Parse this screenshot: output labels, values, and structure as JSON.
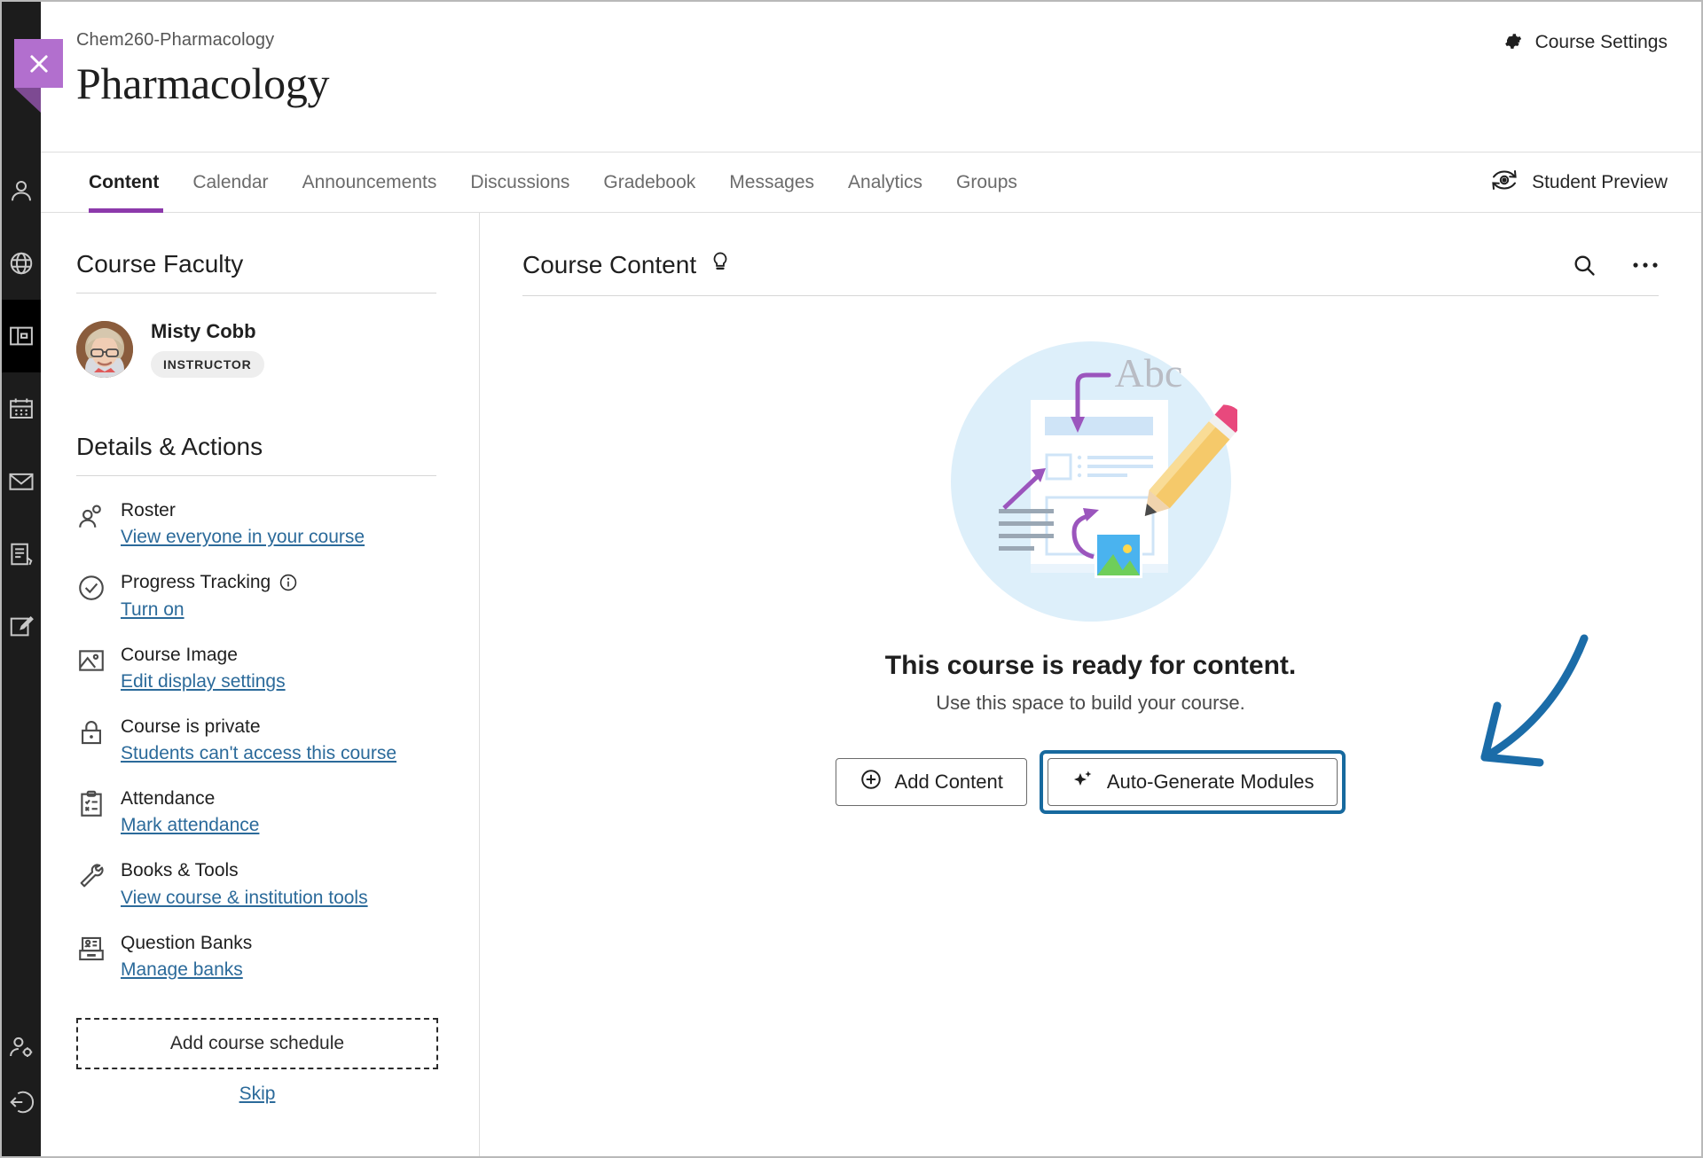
{
  "window": {
    "close_tab": "close-tab"
  },
  "rail": {
    "items": [
      {
        "name": "profile-icon",
        "label": "Profile",
        "active": false
      },
      {
        "name": "institution-page-icon",
        "label": "Institution Page",
        "active": false
      },
      {
        "name": "courses-icon",
        "label": "Courses",
        "active": true
      },
      {
        "name": "calendar-icon",
        "label": "Calendar",
        "active": false
      },
      {
        "name": "messages-icon",
        "label": "Messages",
        "active": false
      },
      {
        "name": "grades-icon",
        "label": "Grades",
        "active": false
      },
      {
        "name": "tools-icon",
        "label": "Tools",
        "active": false
      }
    ],
    "bottom": [
      {
        "name": "admin-icon",
        "label": "Admin",
        "active": false
      },
      {
        "name": "sign-out-icon",
        "label": "Sign Out",
        "active": false
      }
    ]
  },
  "header": {
    "breadcrumb": "Chem260-Pharmacology",
    "title": "Pharmacology",
    "course_settings_label": "Course Settings"
  },
  "tabs": [
    {
      "label": "Content",
      "active": true
    },
    {
      "label": "Calendar",
      "active": false
    },
    {
      "label": "Announcements",
      "active": false
    },
    {
      "label": "Discussions",
      "active": false
    },
    {
      "label": "Gradebook",
      "active": false
    },
    {
      "label": "Messages",
      "active": false
    },
    {
      "label": "Analytics",
      "active": false
    },
    {
      "label": "Groups",
      "active": false
    }
  ],
  "student_preview_label": "Student Preview",
  "faculty": {
    "section_title": "Course Faculty",
    "name": "Misty Cobb",
    "role_badge": "INSTRUCTOR"
  },
  "details": {
    "section_title": "Details & Actions",
    "items": [
      {
        "icon": "roster-icon",
        "label": "Roster",
        "link": "View everyone in your course",
        "has_info": false
      },
      {
        "icon": "progress-icon",
        "label": "Progress Tracking",
        "link": "Turn on",
        "has_info": true
      },
      {
        "icon": "course-image-icon",
        "label": "Course Image",
        "link": "Edit display settings",
        "has_info": false
      },
      {
        "icon": "lock-icon",
        "label": "Course is private",
        "link": "Students can't access this course",
        "has_info": false
      },
      {
        "icon": "attendance-icon",
        "label": "Attendance",
        "link": "Mark attendance",
        "has_info": false
      },
      {
        "icon": "books-tools-icon",
        "label": "Books & Tools",
        "link": "View course & institution tools",
        "has_info": false
      },
      {
        "icon": "question-banks-icon",
        "label": "Question Banks",
        "link": "Manage banks",
        "has_info": false
      }
    ],
    "add_schedule_label": "Add course schedule",
    "skip_label": "Skip"
  },
  "content": {
    "title": "Course Content",
    "empty_title": "This course is ready for content.",
    "empty_subtitle": "Use this space to build your course.",
    "add_content_label": "Add Content",
    "auto_generate_label": "Auto-Generate Modules",
    "illustration_text": "Abc"
  },
  "colors": {
    "accent_purple": "#8c39ab",
    "close_tab_purple": "#b26fce",
    "link_blue": "#2b6a9a",
    "focus_ring_blue": "#17699e",
    "annotation_blue": "#1b6ca8",
    "illustration_bg": "#ddeffa",
    "rail_bg": "#1c1c1c"
  }
}
